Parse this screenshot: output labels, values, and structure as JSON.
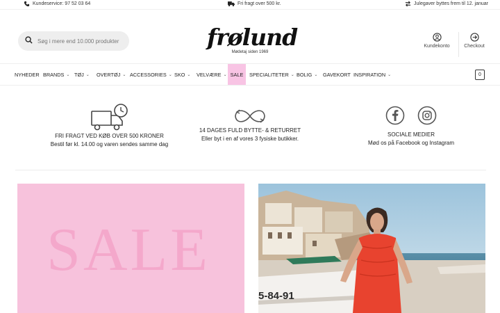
{
  "topbar": {
    "phone_icon": "phone-icon",
    "phone_text": "Kundeservice: 97 52 03 64",
    "truck_icon": "truck-icon",
    "shipping_text": "Fri fragt over 500 kr.",
    "exchange_icon": "exchange-icon",
    "exchange_text": "Julegaver byttes frem til 12. januar"
  },
  "header": {
    "search_placeholder": "Søg i mere end 10.000 produkter",
    "logo_text": "frølund",
    "logo_tagline": "Mødetaj siden 1969",
    "account_label": "Kundekonto",
    "checkout_label": "Checkout"
  },
  "nav": {
    "items": [
      {
        "label": "NYHEDER"
      },
      {
        "label": "BRANDS"
      },
      {
        "label": "TØJ"
      },
      {
        "label": "OVERTØJ"
      },
      {
        "label": "ACCESSORIES"
      },
      {
        "label": "SKO"
      },
      {
        "label": "VELVÆRE"
      },
      {
        "label": "SALE"
      },
      {
        "label": "SPECIALITETER"
      },
      {
        "label": "BOLIG"
      },
      {
        "label": "GAVEKORT"
      },
      {
        "label": "INSPIRATION"
      }
    ],
    "cart_count": "0"
  },
  "features": {
    "shipping_title": "FRI FRAGT VED KØB OVER 500 KRONER",
    "shipping_sub": "Bestil før kl. 14.00 og varen sendes samme dag",
    "returns_title": "14 DAGES FULD BYTTE- & RETURRET",
    "returns_sub": "Eller byt i en af vores 3 fysiske butikker.",
    "social_title": "SOCIALE MEDIER",
    "social_sub": "Mød os på Facebook og Instagram"
  },
  "banners": {
    "sale_text": "SALE",
    "photo_boat_text": "5-84-91"
  },
  "colors": {
    "sale_pink": "#f8c4e4",
    "sale_text_pink": "#f4a8cb",
    "dress_red": "#e8432f"
  }
}
